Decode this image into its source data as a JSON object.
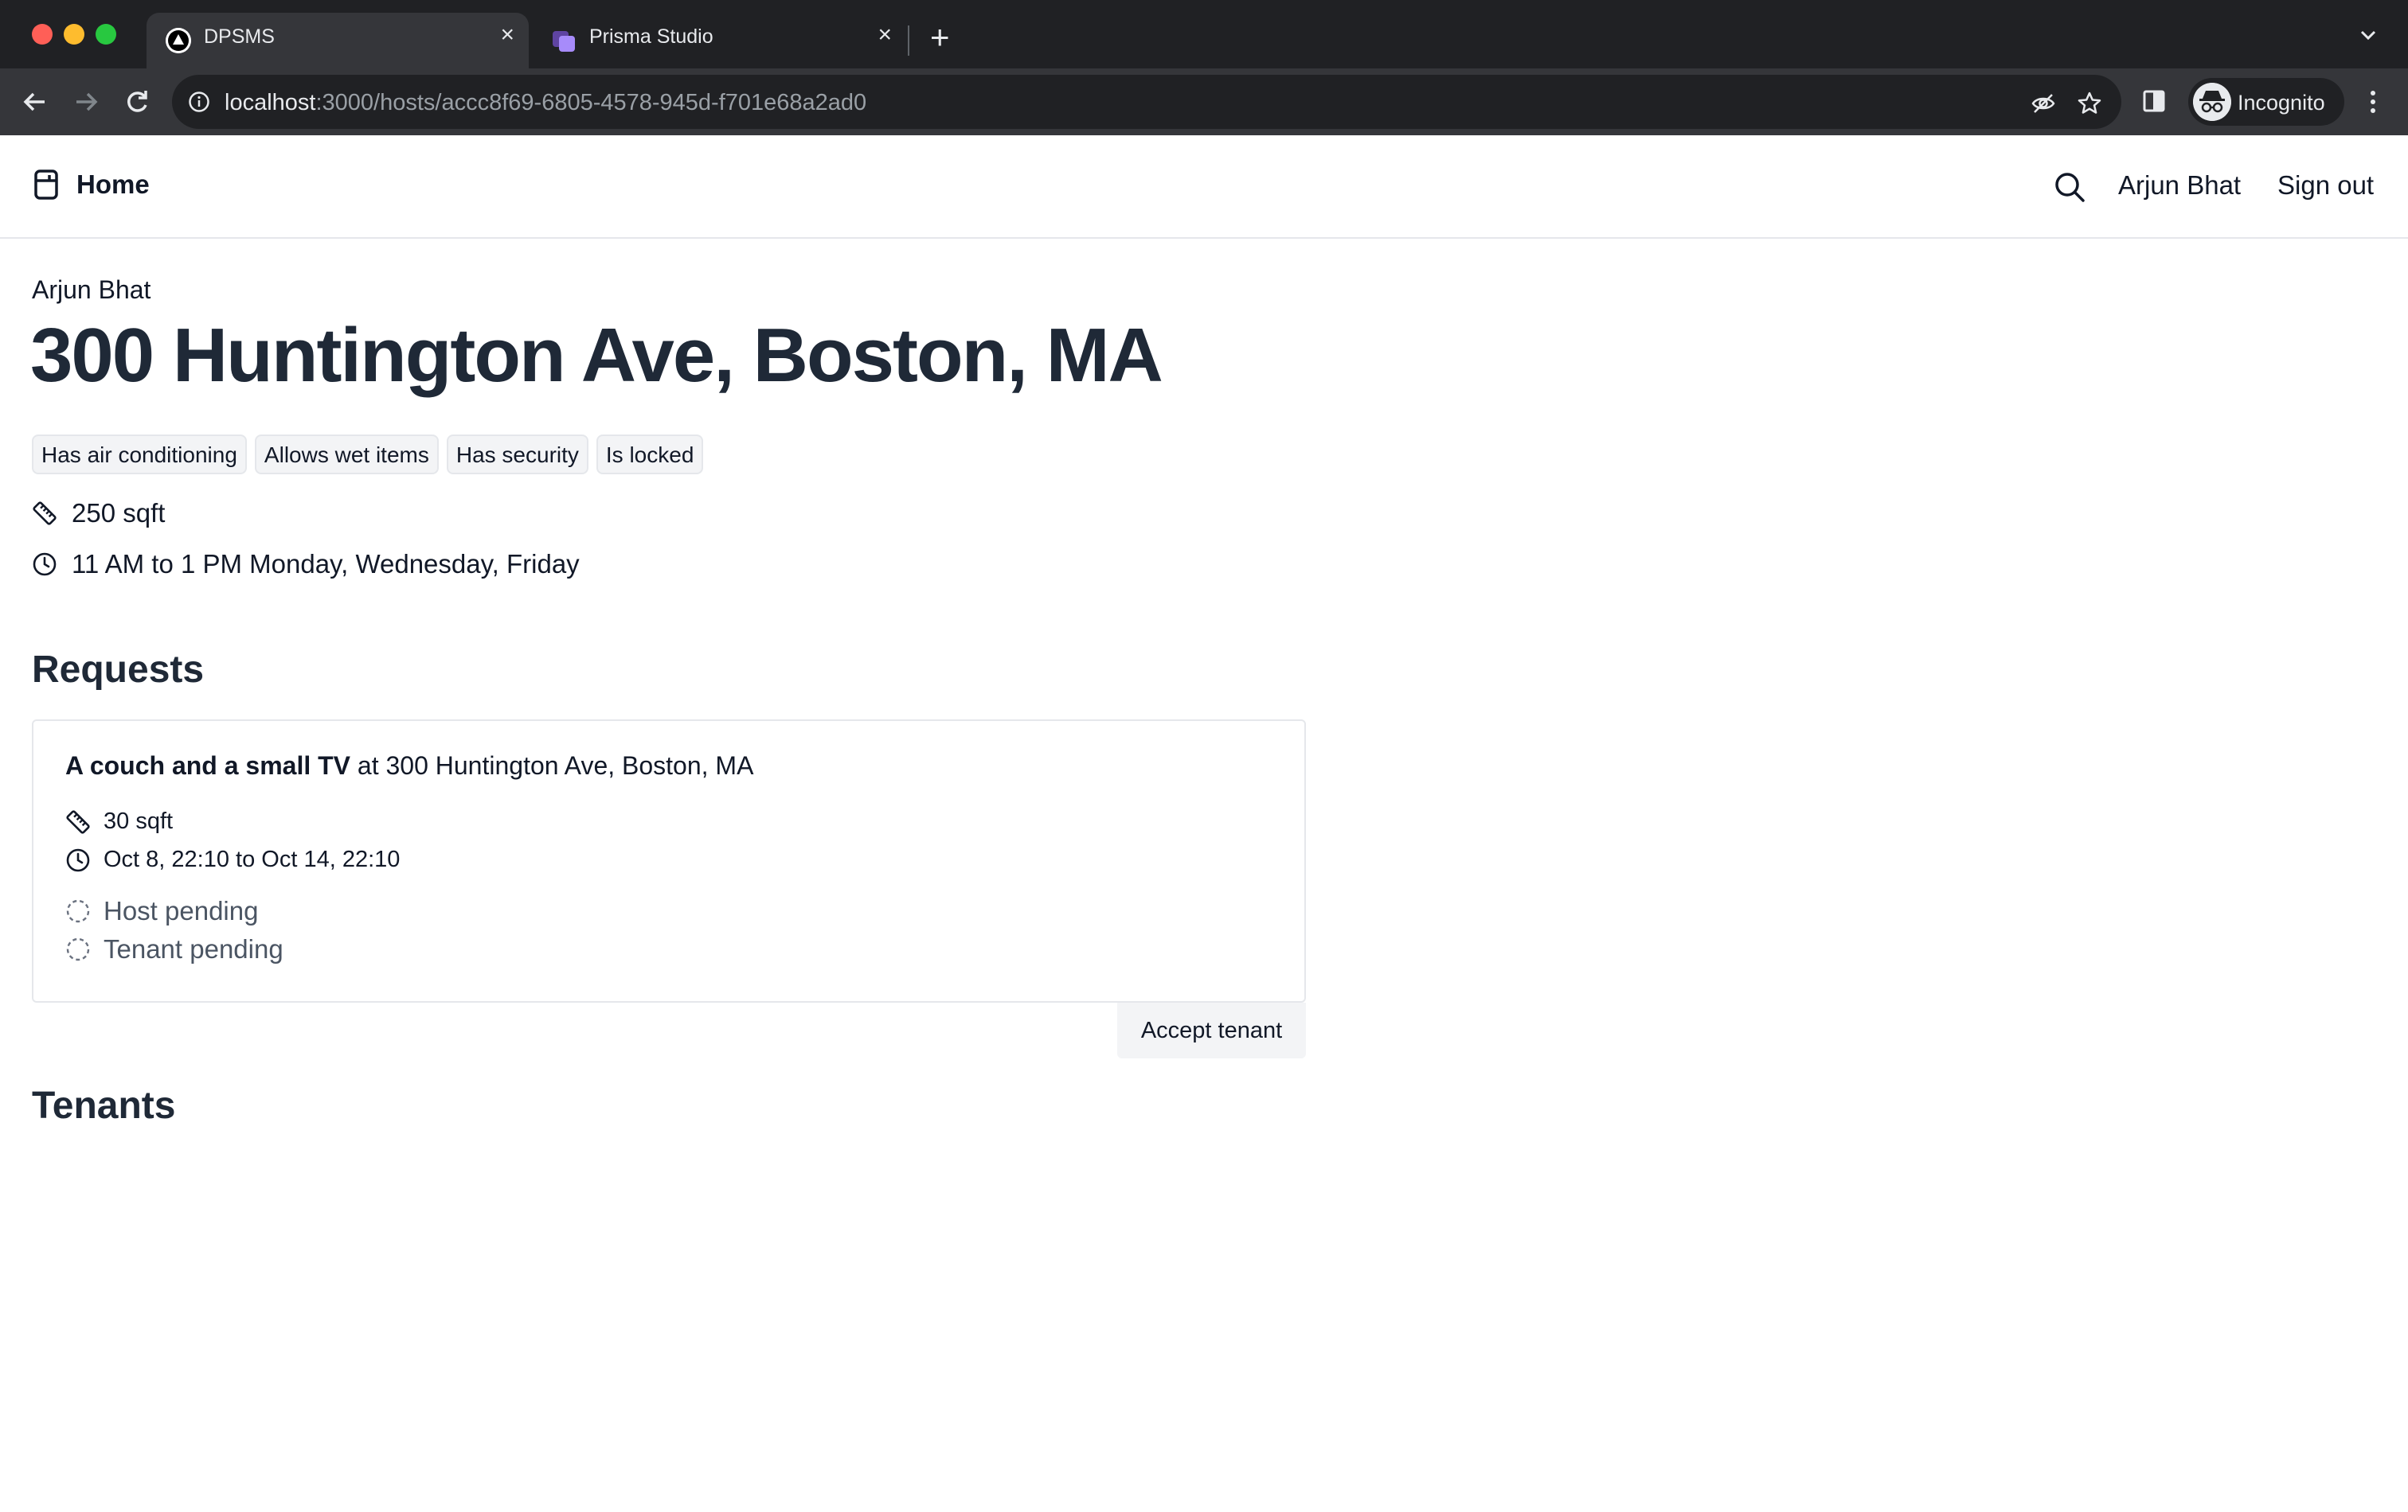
{
  "browser": {
    "tabs": [
      {
        "title": "DPSMS",
        "close_glyph": "×",
        "icon": "triangle-logo-icon",
        "active": true
      },
      {
        "title": "Prisma Studio",
        "close_glyph": "×",
        "icon": "prisma-icon",
        "active": false
      }
    ],
    "new_tab_glyph": "+",
    "url_host": "localhost",
    "url_rest": ":3000/hosts/accc8f69-6805-4578-945d-f701e68a2ad0",
    "profile_label": "Incognito"
  },
  "nav": {
    "home_label": "Home",
    "user_name": "Arjun Bhat",
    "sign_out_label": "Sign out"
  },
  "host": {
    "owner": "Arjun Bhat",
    "address": "300 Huntington Ave, Boston, MA",
    "features": [
      "Has air conditioning",
      "Allows wet items",
      "Has security",
      "Is locked"
    ],
    "area": "250 sqft",
    "hours": "11 AM to 1 PM Monday, Wednesday, Friday"
  },
  "requests": {
    "heading": "Requests",
    "items": [
      {
        "item_name": "A couch and a small TV",
        "location_text": " at 300 Huntington Ave, Boston, MA",
        "area": "30 sqft",
        "dates": "Oct 8, 22:10 to Oct 14, 22:10",
        "host_status": "Host pending",
        "tenant_status": "Tenant pending",
        "action_label": "Accept tenant"
      }
    ]
  },
  "tenants": {
    "heading": "Tenants"
  },
  "colors": {
    "chrome_dark": "#202124",
    "chrome_toolbar": "#35363a",
    "heading": "#1f2937",
    "badge_bg": "#f3f4f6",
    "border": "#e5e7eb",
    "muted": "#4b5563"
  }
}
